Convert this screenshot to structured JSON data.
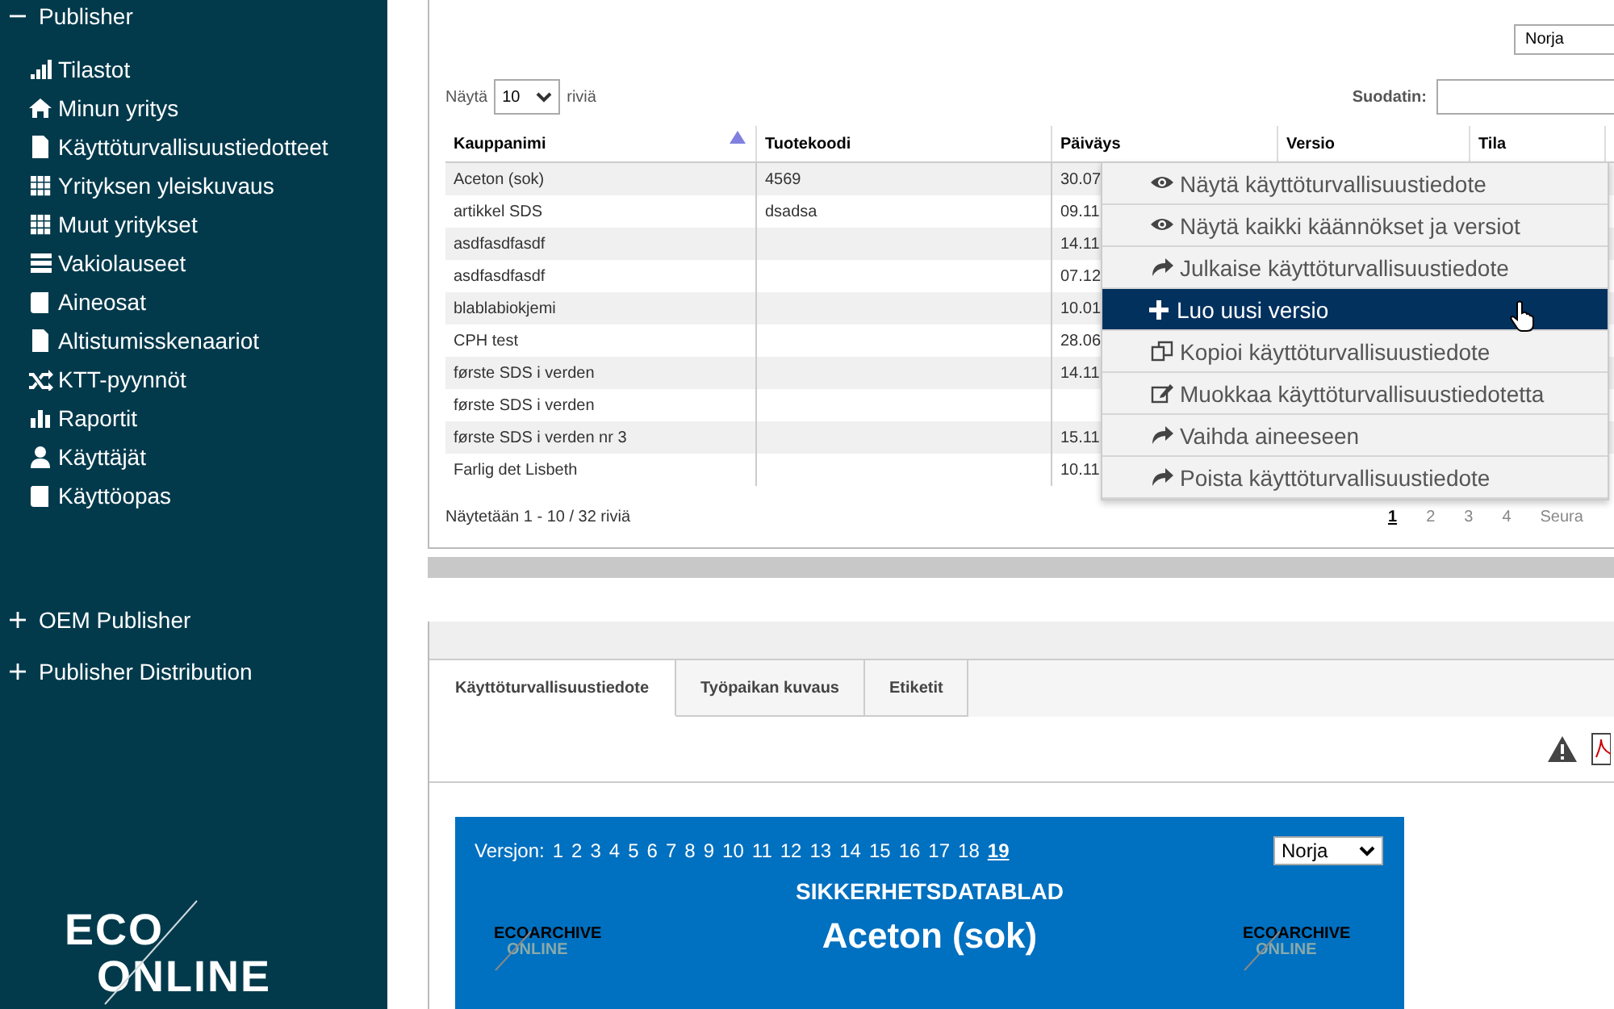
{
  "sidebar": {
    "groups": [
      {
        "label": "Publisher",
        "expanded": true,
        "items": [
          {
            "label": "Tilastot"
          },
          {
            "label": "Minun yritys"
          },
          {
            "label": "Käyttöturvallisuustiedotteet"
          },
          {
            "label": "Yrityksen yleiskuvaus"
          },
          {
            "label": "Muut yritykset"
          },
          {
            "label": "Vakiolauseet"
          },
          {
            "label": "Aineosat"
          },
          {
            "label": "Altistumisskenaariot"
          },
          {
            "label": "KTT-pyynnöt"
          },
          {
            "label": "Raportit"
          },
          {
            "label": "Käyttäjät"
          },
          {
            "label": "Käyttöopas"
          }
        ]
      },
      {
        "label": "OEM Publisher",
        "expanded": false
      },
      {
        "label": "Publisher Distribution",
        "expanded": false
      }
    ],
    "logo": {
      "line_1": "ECO",
      "line_2": "ONLINE"
    }
  },
  "list_panel": {
    "language_select": "Norja",
    "length_before": "Näytä",
    "length_value": "10",
    "length_after": "riviä",
    "filter_label": "Suodatin:",
    "table": {
      "columns": [
        {
          "label": "Kauppanimi",
          "sorted": true
        },
        {
          "label": "Tuotekoodi",
          "sorted": false
        },
        {
          "label": "Päiväys",
          "sorted": false
        },
        {
          "label": "Versio",
          "sorted": false
        },
        {
          "label": "Tila",
          "sorted": false
        }
      ],
      "rows": [
        [
          "Aceton (sok)",
          "4569",
          "30.07"
        ],
        [
          "artikkel SDS",
          "dsadsa",
          "09.11"
        ],
        [
          "asdfasdfasdf",
          "",
          "14.11"
        ],
        [
          "asdfasdfasdf",
          "",
          "07.12"
        ],
        [
          "blablabiokjemi",
          "",
          "10.01"
        ],
        [
          "CPH test",
          "",
          "28.06"
        ],
        [
          "første SDS i verden",
          "",
          "14.11"
        ],
        [
          "første SDS i verden",
          "",
          ""
        ],
        [
          "første SDS i verden nr 3",
          "",
          "15.11"
        ],
        [
          "Farlig det Lisbeth",
          "",
          "10.11"
        ]
      ]
    },
    "info": "Näytetään 1 - 10 / 32 riviä",
    "pages": [
      {
        "label": "1",
        "selected": true
      },
      {
        "label": "2",
        "selected": false
      },
      {
        "label": "3",
        "selected": false
      },
      {
        "label": "4",
        "selected": false
      },
      {
        "label": "Seura",
        "selected": false
      }
    ]
  },
  "context_menu": [
    {
      "label": "Näytä käyttöturvallisuustiedote",
      "selected": false
    },
    {
      "label": "Näytä kaikki käännökset ja versiot",
      "selected": false
    },
    {
      "label": "Julkaise käyttöturvallisuustiedote",
      "selected": false
    },
    {
      "label": "Luo uusi versio",
      "selected": true
    },
    {
      "label": "Kopioi käyttöturvallisuustiedote",
      "selected": false
    },
    {
      "label": "Muokkaa käyttöturvallisuustiedotetta",
      "selected": false
    },
    {
      "label": "Vaihda aineeseen",
      "selected": false
    },
    {
      "label": "Poista käyttöturvallisuustiedote",
      "selected": false
    }
  ],
  "detail_panel": {
    "tabs": [
      {
        "label": "Käyttöturvallisuustiedote",
        "selected": true
      },
      {
        "label": "Työpaikan kuvaus",
        "selected": false
      },
      {
        "label": "Etiketit",
        "selected": false
      }
    ],
    "document": {
      "versions_label": "Versjon:",
      "versions": [
        {
          "label": "1",
          "selected": false
        },
        {
          "label": "2",
          "selected": false
        },
        {
          "label": "3",
          "selected": false
        },
        {
          "label": "4",
          "selected": false
        },
        {
          "label": "5",
          "selected": false
        },
        {
          "label": "6",
          "selected": false
        },
        {
          "label": "7",
          "selected": false
        },
        {
          "label": "8",
          "selected": false
        },
        {
          "label": "9",
          "selected": false
        },
        {
          "label": "10",
          "selected": false
        },
        {
          "label": "11",
          "selected": false
        },
        {
          "label": "12",
          "selected": false
        },
        {
          "label": "13",
          "selected": false
        },
        {
          "label": "14",
          "selected": false
        },
        {
          "label": "15",
          "selected": false
        },
        {
          "label": "16",
          "selected": false
        },
        {
          "label": "17",
          "selected": false
        },
        {
          "label": "18",
          "selected": false
        },
        {
          "label": "19",
          "selected": true
        }
      ],
      "language_select": "Norja",
      "heading": "SIKKERHETSDATABLAD",
      "product": "Aceton (sok)",
      "logos": [
        {
          "line_1": "ECOARCHIVE",
          "line_2": "ONLINE"
        },
        {
          "line_1": "ECOARCHIVE",
          "line_2": "ONLINE"
        }
      ]
    }
  }
}
